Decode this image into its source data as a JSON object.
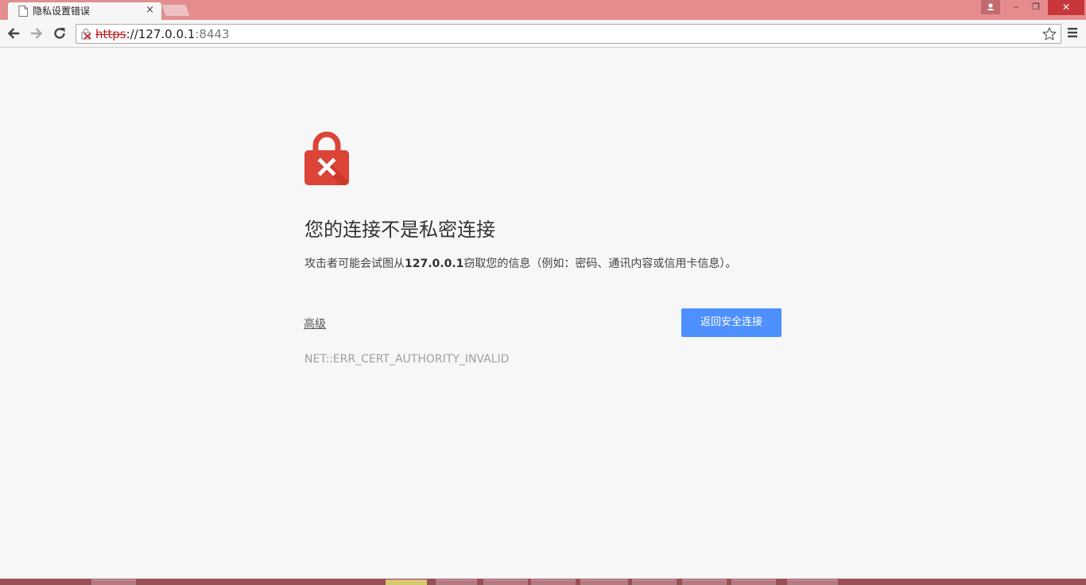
{
  "tab": {
    "title": "隐私设置错误",
    "close": "×"
  },
  "window": {
    "close": "✕",
    "minimize": "–",
    "restore": "❐"
  },
  "omnibox": {
    "scheme": "https",
    "separator": "://",
    "host": "127.0.0.1",
    "port": ":8443"
  },
  "page": {
    "heading": "您的连接不是私密连接",
    "desc_before": "攻击者可能会试图从",
    "desc_host": "127.0.0.1",
    "desc_after": "窃取您的信息（例如：密码、通讯内容或信用卡信息）。",
    "advanced": "高级",
    "back_button": "返回安全连接",
    "error_code": "NET::ERR_CERT_AUTHORITY_INVALID"
  },
  "colors": {
    "titlebar": "#e58c8f",
    "danger": "#db4437",
    "primary": "#4d90fe"
  },
  "icons": {
    "tab": "document-icon",
    "back": "back-arrow-icon",
    "forward": "forward-arrow-icon",
    "reload": "reload-icon",
    "security": "broken-lock-icon",
    "bookmark": "star-icon",
    "menu": "hamburger-menu-icon",
    "hero": "red-padlock-x-icon"
  }
}
